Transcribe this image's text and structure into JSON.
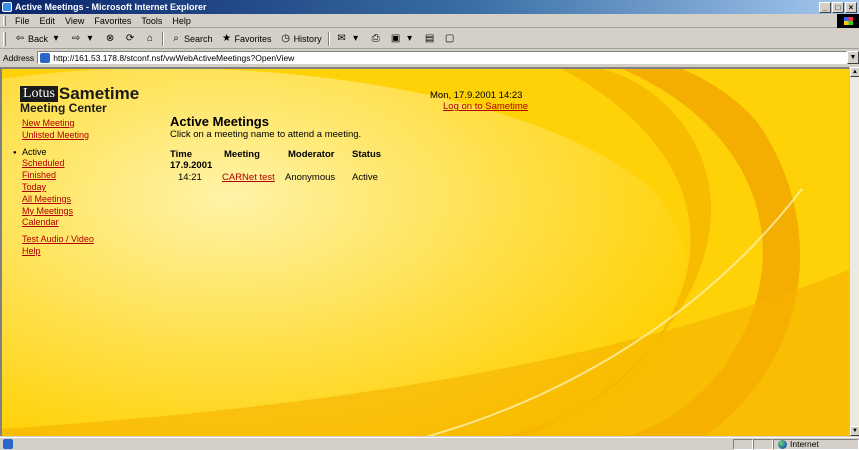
{
  "window": {
    "title": "Active Meetings - Microsoft Internet Explorer",
    "buttons": [
      "_",
      "□",
      "×"
    ]
  },
  "menu": {
    "items": [
      "File",
      "Edit",
      "View",
      "Favorites",
      "Tools",
      "Help"
    ]
  },
  "toolbar": {
    "back": "Back",
    "search": "Search",
    "favorites": "Favorites",
    "history": "History"
  },
  "address": {
    "label": "Address",
    "url": "http://161.53.178.8/stconf.nsf/vwWebActiveMeetings?OpenView"
  },
  "page": {
    "logo_lotus": "Lotus",
    "logo_product": "Sametime",
    "subtitle": "Meeting Center",
    "datetime": "Mon, 17.9.2001 14:23",
    "logon_link": "Log on to Sametime",
    "nav": {
      "new_meeting": "New Meeting",
      "unlisted_meeting": "Unlisted Meeting",
      "active": "Active",
      "scheduled": "Scheduled",
      "finished": "Finished",
      "today": "Today",
      "all_meetings": "All Meetings",
      "my_meetings": "My Meetings",
      "calendar": "Calendar",
      "test_av": "Test Audio / Video",
      "help": "Help"
    },
    "title": "Active Meetings",
    "instruction": "Click on a meeting name to attend a meeting.",
    "table": {
      "headers": {
        "time": "Time",
        "meeting": "Meeting",
        "moderator": "Moderator",
        "status": "Status"
      },
      "date_group": "17.9.2001",
      "rows": [
        {
          "time": "14:21",
          "meeting": "CARNet test",
          "moderator": "Anonymous",
          "status": "Active"
        }
      ]
    }
  },
  "status": {
    "zone": "Internet"
  }
}
